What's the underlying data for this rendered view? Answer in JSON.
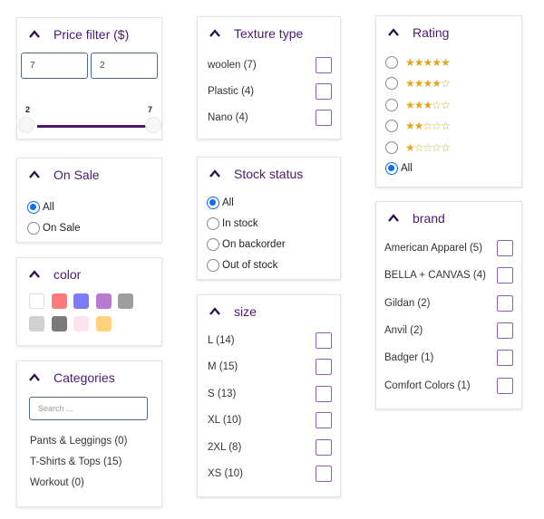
{
  "price_filter": {
    "title": "Price filter ($)",
    "min_input": "7",
    "max_input": "2",
    "slider_min_label": "2",
    "slider_max_label": "7",
    "accent": "#4a1a6e"
  },
  "on_sale": {
    "title": "On Sale",
    "options": [
      {
        "label": "All",
        "selected": true
      },
      {
        "label": "On Sale",
        "selected": false
      }
    ]
  },
  "color": {
    "title": "color",
    "swatches": [
      "#ffffff",
      "#ff7b7b",
      "#7b7bff",
      "#b77bd0",
      "#9e9e9e",
      "#d0d0d0",
      "#7a7a7a",
      "#ffe3ea",
      "#ffd37b"
    ]
  },
  "categories": {
    "title": "Categories",
    "search_placeholder": "Search ...",
    "items": [
      "Pants & Leggings (0)",
      "T-Shirts & Tops (15)",
      "Workout (0)"
    ]
  },
  "texture": {
    "title": "Texture type",
    "items": [
      "woolen (7)",
      "Plastic (4)",
      "Nano (4)"
    ]
  },
  "stock": {
    "title": "Stock status",
    "options": [
      {
        "label": "All",
        "selected": true
      },
      {
        "label": "In stock",
        "selected": false
      },
      {
        "label": "On backorder",
        "selected": false
      },
      {
        "label": "Out of stock",
        "selected": false
      }
    ]
  },
  "size": {
    "title": "size",
    "items": [
      "L (14)",
      "M (15)",
      "S (13)",
      "XL (10)",
      "2XL (8)",
      "XS (10)"
    ]
  },
  "rating": {
    "title": "Rating",
    "options": [
      {
        "stars": 5,
        "selected": false
      },
      {
        "stars": 4,
        "selected": false
      },
      {
        "stars": 3,
        "selected": false
      },
      {
        "stars": 2,
        "selected": false
      },
      {
        "stars": 1,
        "selected": false
      }
    ],
    "all_label": "All",
    "all_selected": true,
    "star_color": "#e0a81e"
  },
  "brand": {
    "title": "brand",
    "items": [
      "American Apparel (5)",
      "BELLA + CANVAS (4)",
      "Gildan (2)",
      "Anvil (2)",
      "Badger (1)",
      "Comfort Colors (1)"
    ]
  }
}
